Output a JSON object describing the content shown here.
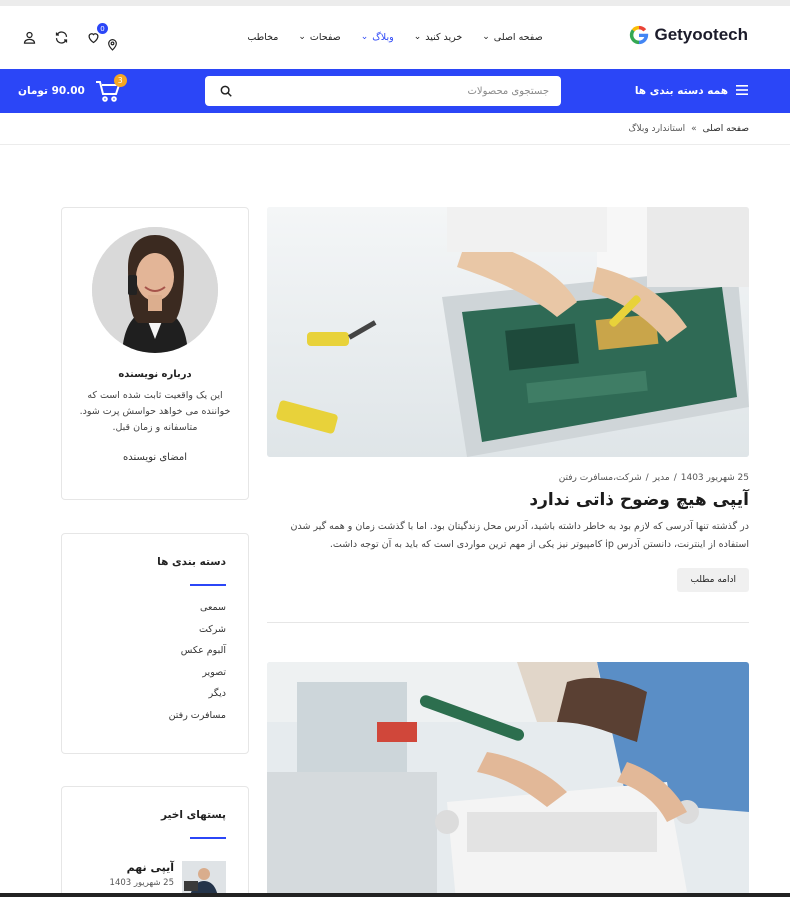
{
  "brand": {
    "name": "Getyootech",
    "accent": "#2b46f7",
    "logo_colors": [
      "#ea4335",
      "#fbbc05",
      "#34a853",
      "#4285f4"
    ]
  },
  "nav": {
    "items": [
      {
        "label": "صفحه اصلی",
        "has_dropdown": true
      },
      {
        "label": "خرید کنید",
        "has_dropdown": true
      },
      {
        "label": "وبلاگ",
        "has_dropdown": true,
        "active": true
      },
      {
        "label": "صفحات",
        "has_dropdown": true
      },
      {
        "label": "مخاطب",
        "has_dropdown": false
      }
    ]
  },
  "header_icons": {
    "compare_badge": "",
    "wishlist_badge": "0",
    "icons": [
      "location-icon",
      "compare-icon",
      "wishlist-icon",
      "user-icon"
    ]
  },
  "bar": {
    "categories_label": "همه دسته بندی ها",
    "search_placeholder": "جستجوی محصولات",
    "cart_total": "90.00 تومان",
    "cart_count": "3"
  },
  "breadcrumb": {
    "home": "صفحه اصلی",
    "separator": "»",
    "current": "استاندارد وبلاگ"
  },
  "posts": [
    {
      "meta_date": "25 شهریور 1403",
      "meta_author": "مدیر",
      "meta_category": "شرکت،مسافرت رفتن",
      "title": "آیپی هیچ وضوح ذاتی ندارد",
      "excerpt": "در گذشته تنها آدرسی که لازم بود به خاطر داشته باشید، آدرس محل زندگیتان بود. اما با گذشت زمان و همه گیر شدن استفاده از اینترنت، دانستن آدرس ip کامپیوتر نیز یکی از مهم ترین مواردی است که باید به آن توجه داشت.",
      "read_more": "ادامه مطلب"
    }
  ],
  "author_widget": {
    "title": "درباره نویسنده",
    "description": "این یک واقعیت ثابت شده است که خواننده می خواهد حواسش پرت شود. متاسفانه و زمان قبل.",
    "signature": "امضای نویسنده"
  },
  "categories_widget": {
    "title": "دسته بندی ها",
    "items": [
      "سمعی",
      "شرکت",
      "آلبوم عکس",
      "تصویر",
      "دیگر",
      "مسافرت رفتن"
    ]
  },
  "recent_widget": {
    "title": "پستهای اخیر",
    "items": [
      {
        "title": "آیپی نهم",
        "date": "25 شهریور 1403"
      }
    ]
  }
}
